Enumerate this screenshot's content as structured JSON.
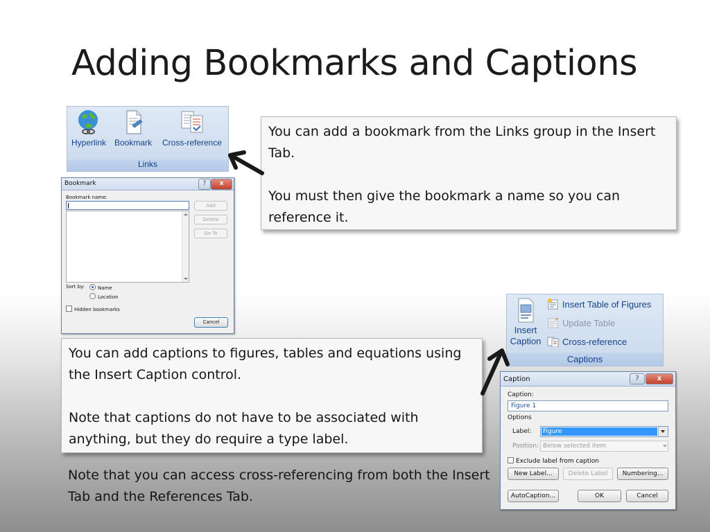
{
  "slide": {
    "title": "Adding Bookmarks and Captions",
    "note_links_1": "You can add a bookmark from the Links group in the Insert Tab.",
    "note_links_2": "You must then give the bookmark a name so you can reference it.",
    "note_captions_1": "You can add captions to figures, tables and equations using the Insert Caption control.",
    "note_captions_2": "Note that captions do not have to be associated with anything, but they do require a type label.",
    "note_crossref": "Note that you can access cross-referencing from both the Insert Tab and the References Tab."
  },
  "links_group": {
    "name": "Links",
    "buttons": [
      {
        "label": "Hyperlink",
        "icon": "globe-link-icon"
      },
      {
        "label": "Bookmark",
        "icon": "bookmark-page-icon"
      },
      {
        "label": "Cross-reference",
        "icon": "cross-reference-icon"
      }
    ]
  },
  "captions_group": {
    "name": "Captions",
    "insert_caption_label_1": "Insert",
    "insert_caption_label_2": "Caption",
    "insert_table_of_figures": "Insert Table of Figures",
    "update_table": "Update Table",
    "cross_reference": "Cross-reference"
  },
  "bookmark_dialog": {
    "title": "Bookmark",
    "help": "?",
    "close": "x",
    "name_label": "Bookmark name:",
    "name_value": "",
    "add": "Add",
    "delete": "Delete",
    "goto": "Go To",
    "sort_by": "Sort by:",
    "sort_name": "Name",
    "sort_location": "Location",
    "hidden_bookmarks": "Hidden bookmarks",
    "cancel": "Cancel"
  },
  "caption_dialog": {
    "title": "Caption",
    "help": "?",
    "close": "x",
    "caption_label": "Caption:",
    "caption_value": "Figure 1",
    "options": "Options",
    "label_label": "Label:",
    "label_value": "Figure",
    "position_label": "Position:",
    "position_value": "Below selected item",
    "exclude_label": "Exclude label from caption",
    "new_label": "New Label...",
    "delete_label": "Delete Label",
    "numbering": "Numbering...",
    "autocaption": "AutoCaption...",
    "ok": "OK",
    "cancel": "Cancel"
  },
  "colors": {
    "ribbon_text": "#15428b",
    "selection": "#3399ff",
    "arrow": "#1a1a1a"
  }
}
